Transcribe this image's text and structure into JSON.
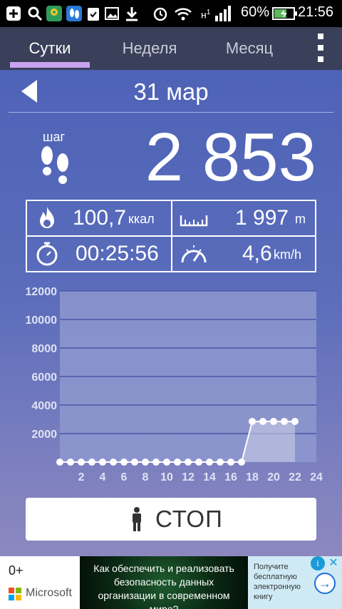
{
  "status_bar": {
    "net": "н",
    "net_sup": "1",
    "battery": "60%",
    "time": "21:56"
  },
  "tabs": [
    {
      "label": "Сутки",
      "active": true
    },
    {
      "label": "Неделя",
      "active": false
    },
    {
      "label": "Месяц",
      "active": false
    }
  ],
  "date": "31 мар",
  "steps": {
    "label": "шаг",
    "value": "2 853"
  },
  "stats": {
    "calories": {
      "value": "100,7",
      "unit": "ккал",
      "icon": "flame-icon"
    },
    "distance": {
      "value": "1 997",
      "unit": "m",
      "icon": "ruler-icon"
    },
    "duration": {
      "value": "00:25:56",
      "icon": "stopwatch-icon"
    },
    "speed": {
      "value": "4,6",
      "unit": "km/h",
      "icon": "speedometer-icon"
    }
  },
  "chart_data": {
    "type": "area",
    "yticks": [
      2000,
      4000,
      6000,
      8000,
      10000,
      12000
    ],
    "xticks": [
      2,
      4,
      6,
      8,
      10,
      12,
      14,
      16,
      18,
      20,
      22,
      24
    ],
    "xlim": [
      0,
      24
    ],
    "ylim": [
      0,
      12000
    ],
    "x": [
      0,
      1,
      2,
      3,
      4,
      5,
      6,
      7,
      8,
      9,
      10,
      11,
      12,
      13,
      14,
      15,
      16,
      17,
      18,
      19,
      20,
      21,
      22
    ],
    "y": [
      0,
      0,
      0,
      0,
      0,
      0,
      0,
      0,
      0,
      0,
      0,
      0,
      0,
      0,
      0,
      0,
      0,
      0,
      2853,
      2853,
      2853,
      2853,
      2853
    ],
    "grid": true,
    "colors": {
      "area": "#c9cbe6",
      "line": "#ffffff",
      "plot_bg": "#8e98cf"
    }
  },
  "stop_button": {
    "label": "СТОП",
    "icon": "person-icon"
  },
  "ad": {
    "count": "0+",
    "brand": "Microsoft",
    "text": "Как обеспечить и реализовать безопасность данных организации в современном мире?",
    "right_text": "Получите бесплатную электронную книгу"
  },
  "colors": {
    "tab_bar": "#3a3f5a",
    "tab_indicator": "#c9a3f1",
    "main_top": "#4e63b7",
    "main_bottom": "#8c88bf"
  }
}
